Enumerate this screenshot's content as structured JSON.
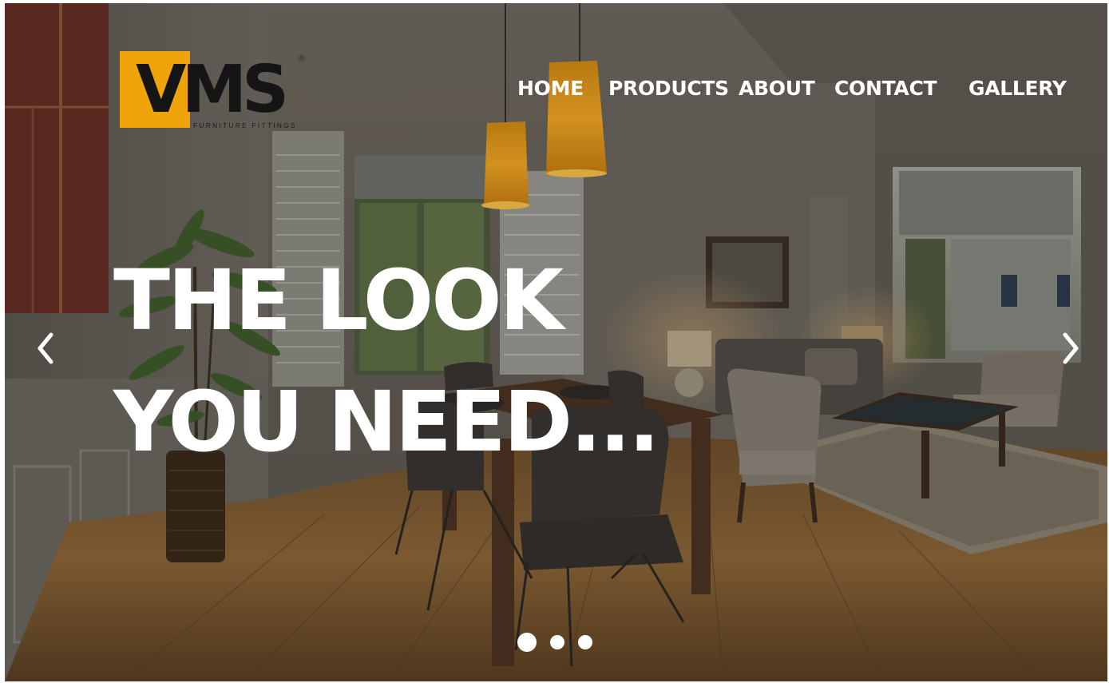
{
  "brand": {
    "logo_text": "VMS",
    "logo_subtitle": "FURNITURE  FITTINGS",
    "registered_mark": "®",
    "accent_color": "#f0a40c"
  },
  "nav": {
    "items": [
      {
        "label": "HOME"
      },
      {
        "label": "PRODUCTS"
      },
      {
        "label": "ABOUT"
      },
      {
        "label": "CONTACT"
      },
      {
        "label": "GALLERY"
      }
    ]
  },
  "hero": {
    "headline_line1": "THE LOOK",
    "headline_line2": "YOU NEED...",
    "prev_icon": "chevron-left-icon",
    "next_icon": "chevron-right-icon",
    "slide_count": 3,
    "active_slide": 1
  }
}
